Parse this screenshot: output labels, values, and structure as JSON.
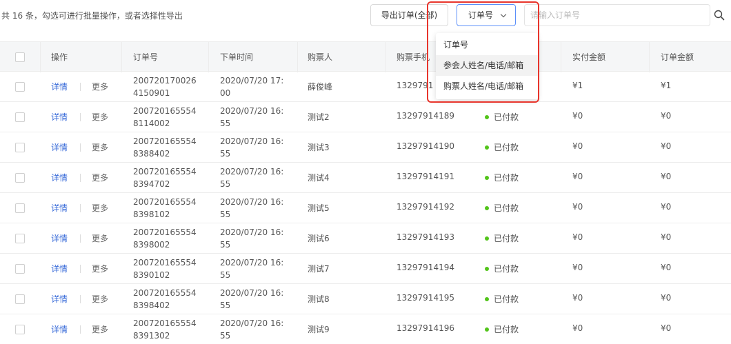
{
  "toolbar": {
    "summary": "共 16 条，勾选可进行批量操作，或者选择性导出",
    "export_label": "导出订单(全部)",
    "select_value": "订单号",
    "search_placeholder": "请输入订单号"
  },
  "dropdown": {
    "options": [
      "订单号",
      "参会人姓名/电话/邮箱",
      "购票人姓名/电话/邮箱"
    ]
  },
  "table": {
    "headers": [
      "操作",
      "订单号",
      "下单时间",
      "购票人",
      "购票手机",
      "实付金额",
      "订单金额"
    ],
    "row_actions": {
      "detail": "详情",
      "more": "更多"
    },
    "rows": [
      {
        "order_l1": "200720170026",
        "order_l2": "4150901",
        "time_l1": "2020/07/20 17:",
        "time_l2": "00",
        "buyer": "薛俊峰",
        "phone": "1329791",
        "status": "",
        "paid": "¥1",
        "amount": "¥1"
      },
      {
        "order_l1": "200720165554",
        "order_l2": "8114002",
        "time_l1": "2020/07/20 16:",
        "time_l2": "55",
        "buyer": "测试2",
        "phone": "13297914189",
        "status": "已付款",
        "paid": "¥0",
        "amount": "¥0"
      },
      {
        "order_l1": "200720165554",
        "order_l2": "8388402",
        "time_l1": "2020/07/20 16:",
        "time_l2": "55",
        "buyer": "测试3",
        "phone": "13297914190",
        "status": "已付款",
        "paid": "¥0",
        "amount": "¥0"
      },
      {
        "order_l1": "200720165554",
        "order_l2": "8394702",
        "time_l1": "2020/07/20 16:",
        "time_l2": "55",
        "buyer": "测试4",
        "phone": "13297914191",
        "status": "已付款",
        "paid": "¥0",
        "amount": "¥0"
      },
      {
        "order_l1": "200720165554",
        "order_l2": "8398102",
        "time_l1": "2020/07/20 16:",
        "time_l2": "55",
        "buyer": "测试5",
        "phone": "13297914192",
        "status": "已付款",
        "paid": "¥0",
        "amount": "¥0"
      },
      {
        "order_l1": "200720165554",
        "order_l2": "8398002",
        "time_l1": "2020/07/20 16:",
        "time_l2": "55",
        "buyer": "测试6",
        "phone": "13297914193",
        "status": "已付款",
        "paid": "¥0",
        "amount": "¥0"
      },
      {
        "order_l1": "200720165554",
        "order_l2": "8390102",
        "time_l1": "2020/07/20 16:",
        "time_l2": "55",
        "buyer": "测试7",
        "phone": "13297914194",
        "status": "已付款",
        "paid": "¥0",
        "amount": "¥0"
      },
      {
        "order_l1": "200720165554",
        "order_l2": "8398402",
        "time_l1": "2020/07/20 16:",
        "time_l2": "55",
        "buyer": "测试8",
        "phone": "13297914195",
        "status": "已付款",
        "paid": "¥0",
        "amount": "¥0"
      },
      {
        "order_l1": "200720165554",
        "order_l2": "8391302",
        "time_l1": "2020/07/20 16:",
        "time_l2": "55",
        "buyer": "测试9",
        "phone": "13297914196",
        "status": "已付款",
        "paid": "¥0",
        "amount": "¥0"
      }
    ]
  },
  "colors": {
    "highlight": "#e8352c",
    "link": "#3a6cd9",
    "status_paid": "#52c41a",
    "select_border": "#5b8ff9"
  }
}
